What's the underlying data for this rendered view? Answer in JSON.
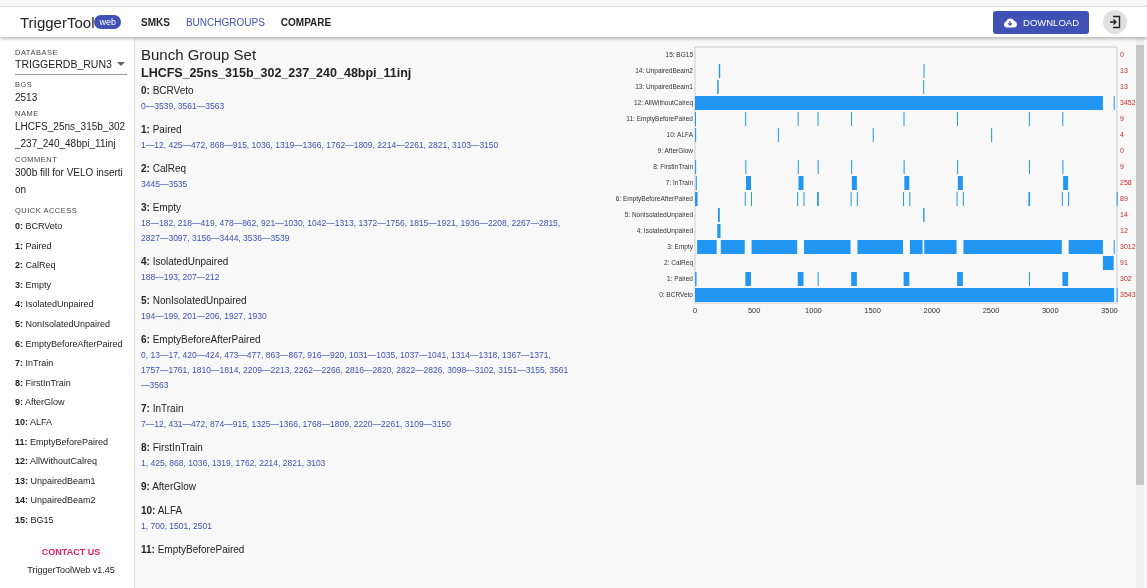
{
  "app": {
    "title": "TriggerTool",
    "badge": "web"
  },
  "nav": [
    {
      "label": "SMKS",
      "selected": false
    },
    {
      "label": "BUNCHGROUPS",
      "selected": true
    },
    {
      "label": "COMPARE",
      "selected": false
    }
  ],
  "download_button": "DOWNLOAD",
  "sidebar": {
    "database": {
      "label": "DATABASE",
      "value": "TRIGGERDB_RUN3"
    },
    "fields": [
      {
        "label": "BGS",
        "value": "2513"
      },
      {
        "label": "NAME",
        "value": "LHCFS_25ns_315b_302_237_240_48bpi_11inj"
      },
      {
        "label": "COMMENT",
        "value": "300b fill for VELO insertion"
      }
    ],
    "quick_access_label": "QUICK ACCESS",
    "quick_access": [
      {
        "index": "0:",
        "name": "BCRVeto"
      },
      {
        "index": "1:",
        "name": "Paired"
      },
      {
        "index": "2:",
        "name": "CalReq"
      },
      {
        "index": "3:",
        "name": "Empty"
      },
      {
        "index": "4:",
        "name": "IsolatedUnpaired"
      },
      {
        "index": "5:",
        "name": "NonIsolatedUnpaired"
      },
      {
        "index": "6:",
        "name": "EmptyBeforeAfterPaired"
      },
      {
        "index": "7:",
        "name": "InTrain"
      },
      {
        "index": "8:",
        "name": "FirstInTrain"
      },
      {
        "index": "9:",
        "name": "AfterGlow"
      },
      {
        "index": "10:",
        "name": "ALFA"
      },
      {
        "index": "11:",
        "name": "EmptyBeforePaired"
      },
      {
        "index": "12:",
        "name": "AllWithoutCalreq"
      },
      {
        "index": "13:",
        "name": "UnpairedBeam1"
      },
      {
        "index": "14:",
        "name": "UnpairedBeam2"
      },
      {
        "index": "15:",
        "name": "BG15"
      }
    ],
    "contact": "CONTACT US",
    "version": "TriggerToolWeb v1.45"
  },
  "main": {
    "title": "Bunch Group Set",
    "set_name": "LHCFS_25ns_315b_302_237_240_48bpi_11inj",
    "groups": [
      {
        "index": "0:",
        "name": "BCRVeto",
        "bunches": "0—3539, 3561—3563"
      },
      {
        "index": "1:",
        "name": "Paired",
        "bunches": "1—12, 425—472, 868—915, 1036, 1319—1366, 1762—1809, 2214—2261, 2821, 3103—3150"
      },
      {
        "index": "2:",
        "name": "CalReq",
        "bunches": "3445—3535"
      },
      {
        "index": "3:",
        "name": "Empty",
        "bunches": "18—182, 218—419, 478—862, 921—1030, 1042—1313, 1372—1756, 1815—1921, 1936—2208, 2267—2815, 2827—3097, 3156—3444, 3536—3539"
      },
      {
        "index": "4:",
        "name": "IsolatedUnpaired",
        "bunches": "188—193, 207—212"
      },
      {
        "index": "5:",
        "name": "NonIsolatedUnpaired",
        "bunches": "194—199, 201—206, 1927, 1930"
      },
      {
        "index": "6:",
        "name": "EmptyBeforeAfterPaired",
        "bunches": "0, 13—17, 420—424, 473—477, 863—867, 916—920, 1031—1035, 1037—1041, 1314—1318, 1367—1371, 1757—1761, 1810—1814, 2209—2213, 2262—2266, 2816—2820, 2822—2826, 3098—3102, 3151—3155, 3561—3563"
      },
      {
        "index": "7:",
        "name": "InTrain",
        "bunches": "7—12, 431—472, 874—915, 1325—1366, 1768—1809, 2220—2261, 3109—3150"
      },
      {
        "index": "8:",
        "name": "FirstInTrain",
        "bunches": "1, 425, 868, 1036, 1319, 1762, 2214, 2821, 3103"
      },
      {
        "index": "9:",
        "name": "AfterGlow"
      },
      {
        "index": "10:",
        "name": "ALFA",
        "bunches": "1, 700, 1501, 2501"
      },
      {
        "index": "11:",
        "name": "EmptyBeforePaired"
      }
    ],
    "bunch_chart": {
      "xticks": [
        "0",
        "500",
        "1000",
        "1500",
        "2000",
        "2500",
        "3000",
        "3500"
      ],
      "rows": [
        {
          "label": "15: BG15",
          "count": "0"
        },
        {
          "label": "14: UnpairedBeam2",
          "count": "13"
        },
        {
          "label": "13: UnpairedBeam1",
          "count": "13"
        },
        {
          "label": "12: AllWithoutCalreq",
          "count": "3452"
        },
        {
          "label": "11: EmptyBeforePaired",
          "count": "9"
        },
        {
          "label": "10: ALFA",
          "count": "4"
        },
        {
          "label": "9: AfterGlow",
          "count": "0"
        },
        {
          "label": "8: FirstInTrain",
          "count": "9"
        },
        {
          "label": "7: InTrain",
          "count": "258"
        },
        {
          "label": "6: EmptyBeforeAfterPaired",
          "count": "89"
        },
        {
          "label": "5: NonIsolatedUnpaired",
          "count": "14"
        },
        {
          "label": "4: IsolatedUnpaired",
          "count": "12"
        },
        {
          "label": "3: Empty",
          "count": "3012"
        },
        {
          "label": "2: CalReq",
          "count": "91"
        },
        {
          "label": "1: Paired",
          "count": "302"
        },
        {
          "label": "0: BCRVeto",
          "count": "3543"
        }
      ]
    }
  }
}
